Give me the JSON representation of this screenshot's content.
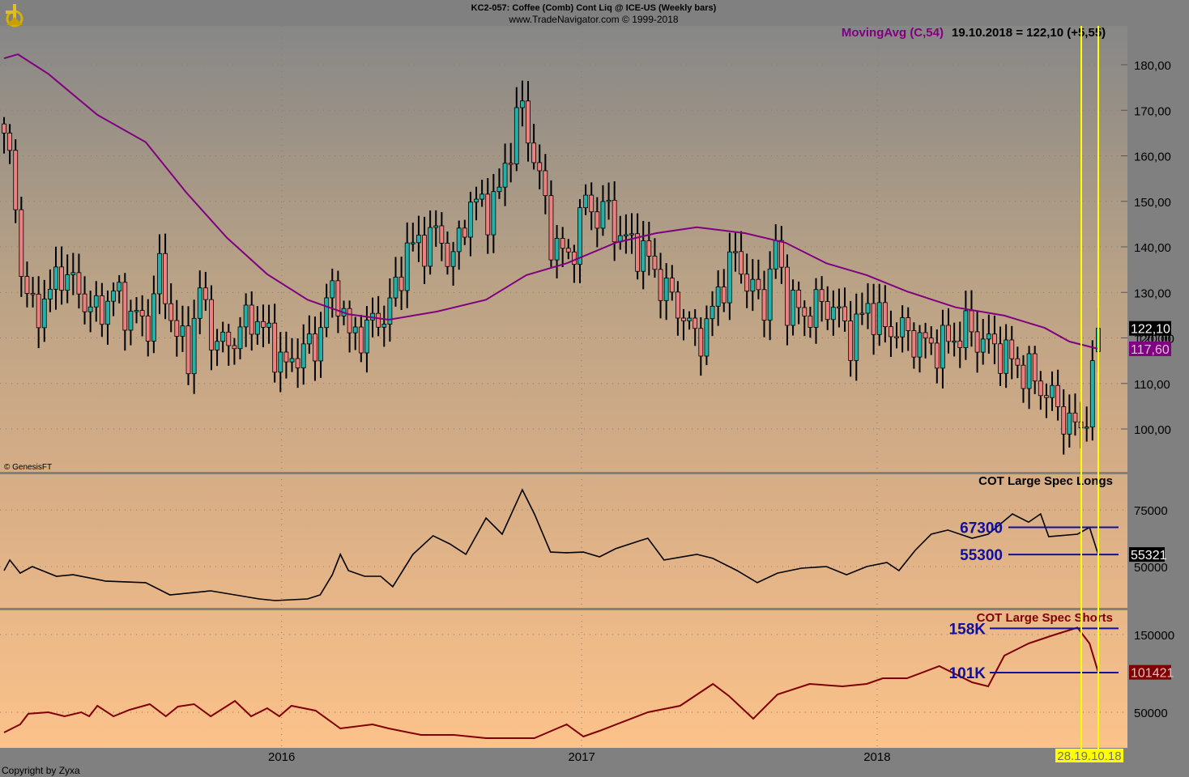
{
  "header": {
    "title": "KC2-057:  Coffee (Comb) Cont Liq @ ICE-US  (Weekly bars)",
    "subtitle": "www.TradeNavigator.com © 1999-2018",
    "indicator_label": "MovingAvg (C,54)",
    "indicator_value": "19.10.2018 = 122,10 (+5,55)",
    "logo_icon": "sextant-logo-icon"
  },
  "footer": {
    "copyright": "Copyright by Zyxa",
    "source": "© GenesisFT",
    "date_marker": "28.19.10.18"
  },
  "colors": {
    "up": "#20b2aa",
    "down": "#f08080",
    "ma": "#800080",
    "level": "#10109c",
    "shorts": "#800000",
    "marker": "#ffff00"
  },
  "chart_data": [
    {
      "type": "candlestick",
      "title": "Coffee weekly price",
      "x_unit": "week index",
      "x_ticks": [
        {
          "week": 48.2,
          "label": "2016"
        },
        {
          "week": 100.3,
          "label": "2017"
        },
        {
          "week": 151.6,
          "label": "2018"
        }
      ],
      "ylim": [
        90,
        187
      ],
      "y_ticks": [
        {
          "v": 100,
          "label": "100,00"
        },
        {
          "v": 110,
          "label": "110,00"
        },
        {
          "v": 120,
          "label": "120,00"
        },
        {
          "v": 130,
          "label": "130,00"
        },
        {
          "v": 140,
          "label": "140,00"
        },
        {
          "v": 150,
          "label": "150,00"
        },
        {
          "v": 160,
          "label": "160,00"
        },
        {
          "v": 170,
          "label": "170,00"
        },
        {
          "v": 180,
          "label": "180,00"
        }
      ],
      "close_anchors": [
        [
          0,
          165
        ],
        [
          2,
          150
        ],
        [
          3,
          135
        ],
        [
          5,
          125
        ],
        [
          8,
          130
        ],
        [
          10,
          135
        ],
        [
          13,
          130
        ],
        [
          16,
          125
        ],
        [
          19,
          130
        ],
        [
          22,
          125
        ],
        [
          25,
          123
        ],
        [
          27,
          135
        ],
        [
          30,
          120
        ],
        [
          32,
          117
        ],
        [
          34,
          130
        ],
        [
          37,
          118
        ],
        [
          40,
          120
        ],
        [
          43,
          125
        ],
        [
          46,
          120
        ],
        [
          49,
          113
        ],
        [
          51,
          117
        ],
        [
          54,
          118
        ],
        [
          56,
          128
        ],
        [
          58,
          130
        ],
        [
          60,
          120
        ],
        [
          63,
          122
        ],
        [
          66,
          125
        ],
        [
          68,
          130
        ],
        [
          70,
          140
        ],
        [
          72,
          140
        ],
        [
          75,
          143
        ],
        [
          78,
          137
        ],
        [
          81,
          150
        ],
        [
          84,
          148
        ],
        [
          86,
          152
        ],
        [
          89,
          168
        ],
        [
          90,
          170
        ],
        [
          91,
          165
        ],
        [
          93,
          155
        ],
        [
          95,
          142
        ],
        [
          98,
          137
        ],
        [
          101,
          150
        ],
        [
          103,
          147
        ],
        [
          105,
          148
        ],
        [
          107,
          142
        ],
        [
          110,
          140
        ],
        [
          112,
          137
        ],
        [
          115,
          130
        ],
        [
          117,
          127
        ],
        [
          120,
          120
        ],
        [
          122,
          122
        ],
        [
          124,
          130
        ],
        [
          127,
          138
        ],
        [
          130,
          130
        ],
        [
          132,
          128
        ],
        [
          134,
          140
        ],
        [
          136,
          128
        ],
        [
          139,
          125
        ],
        [
          141,
          127
        ],
        [
          144,
          127
        ],
        [
          147,
          120
        ],
        [
          150,
          127
        ],
        [
          153,
          122
        ],
        [
          155,
          122
        ],
        [
          158,
          120
        ],
        [
          161,
          118
        ],
        [
          164,
          119
        ],
        [
          167,
          122
        ],
        [
          169,
          120
        ],
        [
          172,
          118
        ],
        [
          175,
          115
        ],
        [
          178,
          112
        ],
        [
          181,
          108
        ],
        [
          184,
          103
        ],
        [
          185,
          101
        ],
        [
          187,
          100
        ],
        [
          188,
          105
        ],
        [
          189,
          115
        ],
        [
          190,
          122.1
        ]
      ],
      "last_close_label": "122,10",
      "series": [
        {
          "name": "MovingAvg (C,54)",
          "type": "line",
          "last_label": "117,60",
          "points": [
            [
              0,
              181.4
            ],
            [
              2.4,
              182.3
            ],
            [
              7.7,
              178
            ],
            [
              16.2,
              169
            ],
            [
              24.6,
              163
            ],
            [
              31.6,
              152
            ],
            [
              38.7,
              142
            ],
            [
              45.7,
              134
            ],
            [
              52.7,
              128.4
            ],
            [
              59.8,
              125.2
            ],
            [
              66.8,
              124
            ],
            [
              75.2,
              125.8
            ],
            [
              83.7,
              128.4
            ],
            [
              90.7,
              133.8
            ],
            [
              97.7,
              136.4
            ],
            [
              106.2,
              140.9
            ],
            [
              113.2,
              143
            ],
            [
              120.3,
              144.3
            ],
            [
              128.7,
              143
            ],
            [
              135.7,
              140.9
            ],
            [
              142.8,
              136.4
            ],
            [
              149.8,
              133.8
            ],
            [
              156.8,
              130.2
            ],
            [
              165.3,
              126.7
            ],
            [
              173.7,
              124.9
            ],
            [
              180.7,
              122.2
            ],
            [
              185,
              119.2
            ],
            [
              190,
              117.6
            ]
          ]
        }
      ],
      "overlay_label": "120,00"
    },
    {
      "type": "line",
      "title": "COT Large Spec Longs",
      "ylim": [
        28000,
        93000
      ],
      "y_ticks": [
        {
          "v": 50000,
          "label": "50000"
        },
        {
          "v": 75000,
          "label": "75000"
        }
      ],
      "levels": [
        {
          "v": 67300,
          "label": "67300"
        },
        {
          "v": 55300,
          "label": "55300"
        }
      ],
      "last_label": "55321",
      "points": [
        [
          0,
          48200
        ],
        [
          1,
          52900
        ],
        [
          2.8,
          47100
        ],
        [
          4.9,
          50000
        ],
        [
          9.1,
          45700
        ],
        [
          12,
          46400
        ],
        [
          17.6,
          43600
        ],
        [
          24.6,
          42900
        ],
        [
          28.8,
          37500
        ],
        [
          35.9,
          39300
        ],
        [
          44.3,
          35700
        ],
        [
          47.1,
          35000
        ],
        [
          52.7,
          35700
        ],
        [
          54.9,
          37500
        ],
        [
          57,
          46400
        ],
        [
          58.4,
          55400
        ],
        [
          59.8,
          48200
        ],
        [
          62.6,
          45700
        ],
        [
          65.4,
          45700
        ],
        [
          67.5,
          41100
        ],
        [
          71,
          55400
        ],
        [
          74.5,
          63600
        ],
        [
          77.4,
          60000
        ],
        [
          80.2,
          55400
        ],
        [
          83.7,
          71400
        ],
        [
          86.5,
          64300
        ],
        [
          90,
          83900
        ],
        [
          92.1,
          73200
        ],
        [
          94.9,
          56400
        ],
        [
          97.7,
          56100
        ],
        [
          100.6,
          56400
        ],
        [
          103.4,
          54300
        ],
        [
          106.2,
          57900
        ],
        [
          110.4,
          61400
        ],
        [
          111.8,
          62500
        ],
        [
          114.6,
          52900
        ],
        [
          120.3,
          55400
        ],
        [
          123.1,
          53600
        ],
        [
          127.3,
          48200
        ],
        [
          130.8,
          42900
        ],
        [
          134.3,
          47100
        ],
        [
          138.5,
          49300
        ],
        [
          142.8,
          50000
        ],
        [
          146.3,
          46400
        ],
        [
          149.8,
          50000
        ],
        [
          153.3,
          51800
        ],
        [
          155.4,
          48200
        ],
        [
          158.2,
          57100
        ],
        [
          161,
          64300
        ],
        [
          163.9,
          66100
        ],
        [
          168.1,
          62500
        ],
        [
          170.9,
          64300
        ],
        [
          175.1,
          73200
        ],
        [
          177.9,
          69600
        ],
        [
          180,
          73200
        ],
        [
          181.4,
          63200
        ],
        [
          186.4,
          64300
        ],
        [
          188.5,
          67300
        ],
        [
          190,
          55321
        ]
      ]
    },
    {
      "type": "line",
      "title": "COT Large Spec Shorts",
      "ylim": [
        10000,
        185000
      ],
      "y_ticks": [
        {
          "v": 50000,
          "label": "50000"
        },
        {
          "v": 150000,
          "label": "150000"
        }
      ],
      "levels": [
        {
          "v": 158000,
          "label": "158K"
        },
        {
          "v": 101000,
          "label": "101K"
        }
      ],
      "last_label": "101421",
      "points": [
        [
          0,
          24000
        ],
        [
          2.8,
          34400
        ],
        [
          4.2,
          48000
        ],
        [
          7.7,
          50000
        ],
        [
          10.5,
          44800
        ],
        [
          13.4,
          50000
        ],
        [
          14.8,
          44800
        ],
        [
          16.2,
          58300
        ],
        [
          19,
          44800
        ],
        [
          21.8,
          53100
        ],
        [
          25.3,
          60400
        ],
        [
          28.1,
          44800
        ],
        [
          30.2,
          57300
        ],
        [
          33,
          60400
        ],
        [
          35.9,
          44800
        ],
        [
          40.1,
          64600
        ],
        [
          42.9,
          44800
        ],
        [
          45.7,
          55200
        ],
        [
          47.8,
          44800
        ],
        [
          49.9,
          58300
        ],
        [
          54.1,
          52100
        ],
        [
          58.4,
          29200
        ],
        [
          64,
          34400
        ],
        [
          66.8,
          29200
        ],
        [
          72.4,
          20800
        ],
        [
          78.1,
          20800
        ],
        [
          83.7,
          16700
        ],
        [
          89.3,
          16700
        ],
        [
          92.1,
          16700
        ],
        [
          97.7,
          34400
        ],
        [
          100.6,
          18800
        ],
        [
          103.4,
          26000
        ],
        [
          111.8,
          50000
        ],
        [
          117.4,
          58300
        ],
        [
          123.1,
          86500
        ],
        [
          125.9,
          70800
        ],
        [
          130.1,
          41700
        ],
        [
          134.3,
          72900
        ],
        [
          139.9,
          86500
        ],
        [
          145.6,
          83300
        ],
        [
          149.8,
          86500
        ],
        [
          152.6,
          93800
        ],
        [
          156.8,
          93800
        ],
        [
          162.4,
          109400
        ],
        [
          168.1,
          88500
        ],
        [
          170.9,
          83300
        ],
        [
          173.7,
          122900
        ],
        [
          177.9,
          138500
        ],
        [
          182.1,
          149000
        ],
        [
          186.4,
          159000
        ],
        [
          188.5,
          138500
        ],
        [
          190,
          101421
        ]
      ]
    }
  ]
}
